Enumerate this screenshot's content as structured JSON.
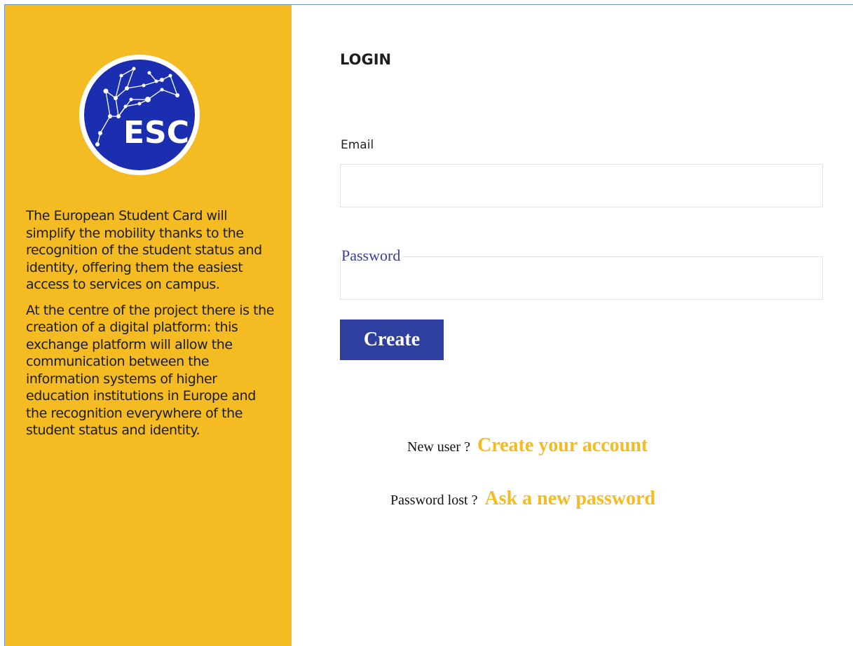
{
  "sidebar": {
    "logo_text": "ESC",
    "paragraphs": [
      "The European Student Card will simplify the mobility thanks to the recognition of the student status and identity, offering them the easiest access to services on campus.",
      "At the centre of the project there is the creation of a digital platform: this exchange platform will allow the communication between the information systems of higher education institutions in Europe and the recognition everywhere of the student status and identity."
    ]
  },
  "login": {
    "title": "LOGIN",
    "email_label": "Email",
    "email_value": "",
    "password_label": "Password",
    "password_value": "",
    "submit_label": "Create"
  },
  "links": {
    "new_user_prompt": "New user ?",
    "create_account": "Create your account",
    "password_lost_prompt": "Password lost ?",
    "ask_password": "Ask a new password"
  },
  "colors": {
    "sidebar_bg": "#f4bb22",
    "logo_blue": "#1b2eb0",
    "button_bg": "#2f3fa0",
    "link": "#f4bb22"
  },
  "icons": {
    "logo": "european-student-card-logo"
  }
}
